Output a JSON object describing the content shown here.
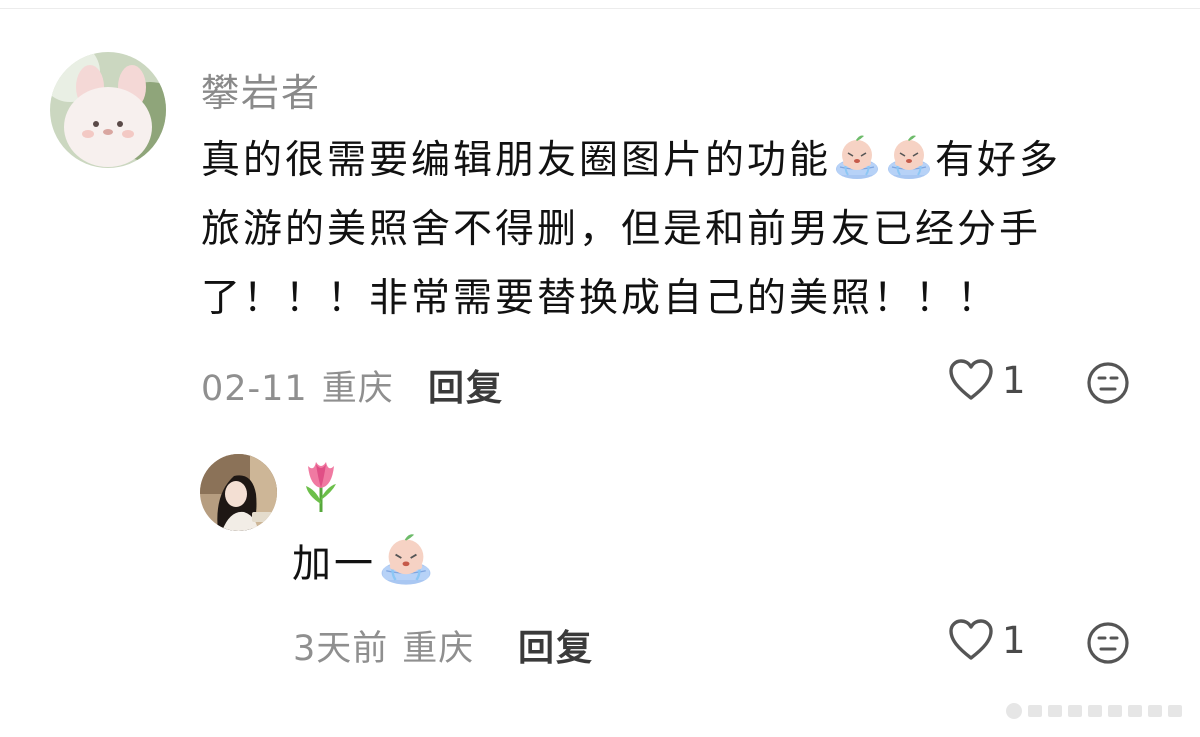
{
  "comments": [
    {
      "username": "攀岩者",
      "avatar": "plush-bunny-avatar",
      "lines": [
        {
          "pre": "真的很需要编辑朋友圈图片的功能",
          "emoji_count": 2,
          "post": "有好多"
        },
        {
          "text": "旅游的美照舍不得删，但是和前男友已经分手"
        },
        {
          "text": "了！！！非常需要替换成自己的美照！！！"
        }
      ],
      "date": "02-11",
      "location": "重庆",
      "reply_label": "回复",
      "like_count": "1"
    },
    {
      "username_emoji": "🌷",
      "avatar": "girl-photo-avatar",
      "text": "加一",
      "emoji_count": 1,
      "date": "3天前",
      "location": "重庆",
      "reply_label": "回复",
      "like_count": "1"
    }
  ],
  "icons": {
    "like": "heart-outline-icon",
    "react": "neutral-face-icon",
    "sticker": "crying-peach-sticker"
  },
  "colors": {
    "text_primary": "#111111",
    "text_secondary": "#8f8f8f",
    "icon_gray": "#555555"
  }
}
